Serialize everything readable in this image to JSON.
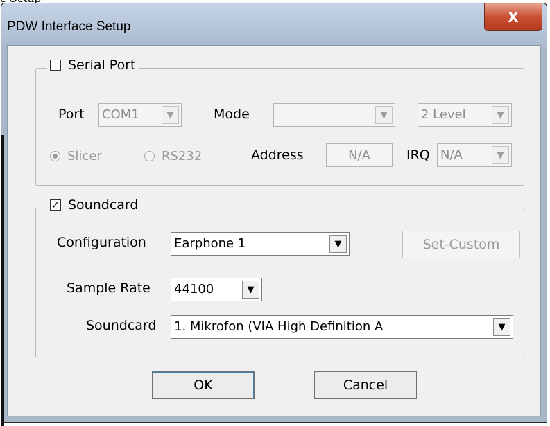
{
  "background_title": "e Setup",
  "window": {
    "title": "PDW Interface Setup",
    "close_glyph": "X"
  },
  "serial_port": {
    "label": "Serial Port",
    "checked": false,
    "port_label": "Port",
    "port_value": "COM1",
    "mode_label": "Mode",
    "mode_value": "",
    "level_value": "2 Level",
    "slicer_label": "Slicer",
    "rs232_label": "RS232",
    "selected_interface": "Slicer",
    "address_label": "Address",
    "address_value": "N/A",
    "irq_label": "IRQ",
    "irq_value": "N/A"
  },
  "soundcard": {
    "label": "Soundcard",
    "checked": true,
    "check_glyph": "✓",
    "configuration_label": "Configuration",
    "configuration_value": "Earphone 1",
    "set_custom_label": "Set-Custom",
    "sample_rate_label": "Sample Rate",
    "sample_rate_value": "44100",
    "device_label": "Soundcard",
    "device_value": "1. Mikrofon (VIA High Definition A"
  },
  "buttons": {
    "ok": "OK",
    "cancel": "Cancel"
  },
  "icons": {
    "dropdown_arrow": "▼",
    "close": "close-icon"
  },
  "colors": {
    "titlebar": "#c4d4e6",
    "close_button": "#c75034",
    "client_bg": "#f0f0f0"
  }
}
